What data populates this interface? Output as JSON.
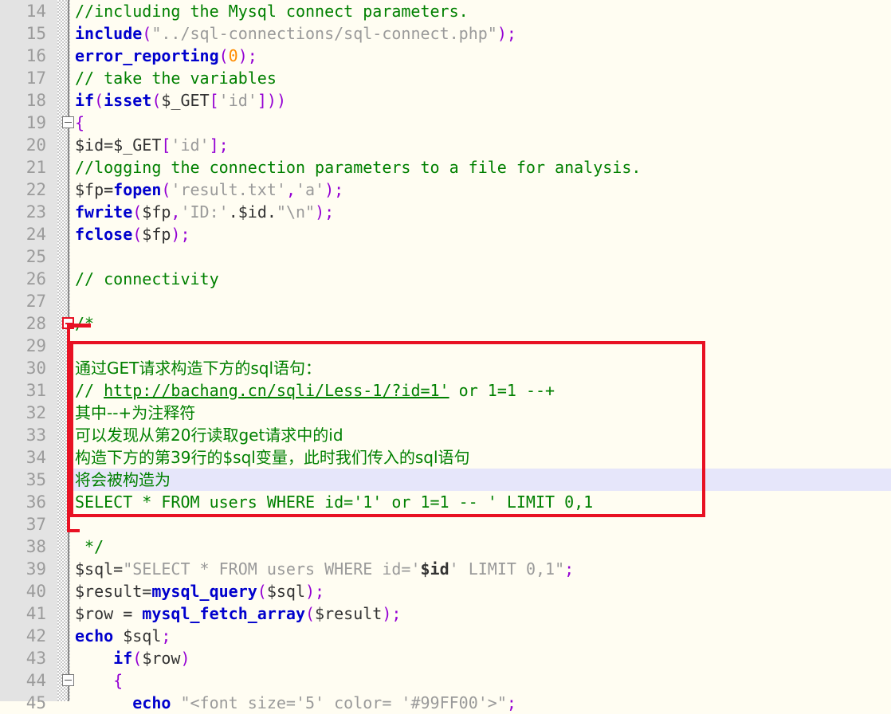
{
  "editor": {
    "title": "php-code-editor",
    "language": "PHP",
    "current_line": 35,
    "first_visible_line": 14,
    "last_visible_line": 45,
    "colors": {
      "background": "#fffdf2",
      "gutter_background": "#e3e3e3",
      "line_number": "#9b9b9b",
      "current_line_highlight": "#e6e6fa",
      "comment": "#008000",
      "keyword": "#0000cd",
      "function": "#0000cd",
      "string": "#9a9a9a",
      "punctuation": "#9400d3",
      "number": "#ff8c00",
      "annotation_box_border": "#e81123",
      "fold_marker_red": "#e81123"
    }
  },
  "annotation": {
    "name": "red-highlight-box",
    "covers_lines": [
      30,
      36
    ],
    "border_color": "#e81123"
  },
  "fold_markers": [
    {
      "line": 19,
      "type": "collapse",
      "color": "gray"
    },
    {
      "line": 28,
      "type": "collapse",
      "color": "red"
    },
    {
      "line": 44,
      "type": "collapse",
      "color": "gray"
    }
  ],
  "lines": [
    {
      "number": 14,
      "text": "//including the Mysql connect parameters.",
      "tokens": [
        {
          "t": "//including the Mysql connect parameters.",
          "c": "cmt"
        }
      ]
    },
    {
      "number": 15,
      "text": "include(\"../sql-connections/sql-connect.php\");",
      "tokens": [
        {
          "t": "include",
          "c": "kw"
        },
        {
          "t": "(",
          "c": "punct"
        },
        {
          "t": "\"../sql-connections/sql-connect.php\"",
          "c": "str"
        },
        {
          "t": ")",
          "c": "punct"
        },
        {
          "t": ";",
          "c": "punct"
        }
      ]
    },
    {
      "number": 16,
      "text": "error_reporting(0);",
      "tokens": [
        {
          "t": "error_reporting",
          "c": "fn"
        },
        {
          "t": "(",
          "c": "punct"
        },
        {
          "t": "0",
          "c": "num"
        },
        {
          "t": ")",
          "c": "punct"
        },
        {
          "t": ";",
          "c": "punct"
        }
      ]
    },
    {
      "number": 17,
      "text": "// take the variables",
      "tokens": [
        {
          "t": "// take the variables",
          "c": "cmt"
        }
      ]
    },
    {
      "number": 18,
      "text": "if(isset($_GET['id']))",
      "tokens": [
        {
          "t": "if",
          "c": "kw"
        },
        {
          "t": "(",
          "c": "punct"
        },
        {
          "t": "isset",
          "c": "fn"
        },
        {
          "t": "(",
          "c": "punct"
        },
        {
          "t": "$_GET",
          "c": "plain"
        },
        {
          "t": "[",
          "c": "punct"
        },
        {
          "t": "'id'",
          "c": "str"
        },
        {
          "t": "]",
          "c": "punct"
        },
        {
          "t": ")",
          "c": "punct"
        },
        {
          "t": ")",
          "c": "punct"
        }
      ]
    },
    {
      "number": 19,
      "text": "{",
      "tokens": [
        {
          "t": "{",
          "c": "punct"
        }
      ]
    },
    {
      "number": 20,
      "text": "$id=$_GET['id'];",
      "tokens": [
        {
          "t": "$id=$_GET",
          "c": "plain"
        },
        {
          "t": "[",
          "c": "punct"
        },
        {
          "t": "'id'",
          "c": "str"
        },
        {
          "t": "]",
          "c": "punct"
        },
        {
          "t": ";",
          "c": "punct"
        }
      ]
    },
    {
      "number": 21,
      "text": "//logging the connection parameters to a file for analysis.",
      "tokens": [
        {
          "t": "//logging the connection parameters to a file for analysis.",
          "c": "cmt"
        }
      ]
    },
    {
      "number": 22,
      "text": "$fp=fopen('result.txt','a');",
      "tokens": [
        {
          "t": "$fp=",
          "c": "plain"
        },
        {
          "t": "fopen",
          "c": "fn"
        },
        {
          "t": "(",
          "c": "punct"
        },
        {
          "t": "'result.txt'",
          "c": "str"
        },
        {
          "t": ",",
          "c": "punct"
        },
        {
          "t": "'a'",
          "c": "str"
        },
        {
          "t": ")",
          "c": "punct"
        },
        {
          "t": ";",
          "c": "punct"
        }
      ]
    },
    {
      "number": 23,
      "text": "fwrite($fp,'ID:'.$id.\"\\n\");",
      "tokens": [
        {
          "t": "fwrite",
          "c": "fn"
        },
        {
          "t": "(",
          "c": "punct"
        },
        {
          "t": "$fp",
          "c": "plain"
        },
        {
          "t": ",",
          "c": "punct"
        },
        {
          "t": "'ID:'",
          "c": "str"
        },
        {
          "t": ".",
          "c": "plain"
        },
        {
          "t": "$id",
          "c": "plain"
        },
        {
          "t": ".",
          "c": "plain"
        },
        {
          "t": "\"\\n\"",
          "c": "str"
        },
        {
          "t": ")",
          "c": "punct"
        },
        {
          "t": ";",
          "c": "punct"
        }
      ]
    },
    {
      "number": 24,
      "text": "fclose($fp);",
      "tokens": [
        {
          "t": "fclose",
          "c": "fn"
        },
        {
          "t": "(",
          "c": "punct"
        },
        {
          "t": "$fp",
          "c": "plain"
        },
        {
          "t": ")",
          "c": "punct"
        },
        {
          "t": ";",
          "c": "punct"
        }
      ]
    },
    {
      "number": 25,
      "text": "",
      "tokens": []
    },
    {
      "number": 26,
      "text": "// connectivity",
      "tokens": [
        {
          "t": "// connectivity",
          "c": "cmt"
        }
      ]
    },
    {
      "number": 27,
      "text": "",
      "tokens": []
    },
    {
      "number": 28,
      "text": "/*",
      "tokens": [
        {
          "t": "/*",
          "c": "cmt"
        }
      ]
    },
    {
      "number": 29,
      "text": "",
      "tokens": []
    },
    {
      "number": 30,
      "text": "通过GET请求构造下方的sql语句：",
      "tokens": [
        {
          "t": "通过GET请求构造下方的sql语句：",
          "c": "cmt cjk"
        }
      ]
    },
    {
      "number": 31,
      "text": "// http://bachang.cn/sqli/Less-1/?id=1' or 1=1 --+",
      "tokens": [
        {
          "t": "// ",
          "c": "cmt"
        },
        {
          "t": "http://bachang.cn/sqli/Less-1/?id=1'",
          "c": "link"
        },
        {
          "t": " or 1=1 --+",
          "c": "cmt"
        }
      ]
    },
    {
      "number": 32,
      "text": "其中--+为注释符",
      "tokens": [
        {
          "t": "其中--+为注释符",
          "c": "cmt cjk"
        }
      ]
    },
    {
      "number": 33,
      "text": "可以发现从第20行读取get请求中的id",
      "tokens": [
        {
          "t": "可以发现从第20行读取get请求中的id",
          "c": "cmt cjk"
        }
      ]
    },
    {
      "number": 34,
      "text": "构造下方的第39行的$sql变量，此时我们传入的sql语句",
      "tokens": [
        {
          "t": "构造下方的第39行的$sql变量，此时我们传入的sql语句",
          "c": "cmt cjk"
        }
      ]
    },
    {
      "number": 35,
      "text": "将会被构造为",
      "current": true,
      "tokens": [
        {
          "t": "将会被构造为",
          "c": "cmt cjk"
        }
      ]
    },
    {
      "number": 36,
      "text": "SELECT * FROM users WHERE id='1' or 1=1 -- ' LIMIT 0,1",
      "tokens": [
        {
          "t": "SELECT * FROM users WHERE id='1' or 1=1 -- ' LIMIT 0,1",
          "c": "cmt"
        }
      ]
    },
    {
      "number": 37,
      "text": "",
      "tokens": []
    },
    {
      "number": 38,
      "text": " */",
      "tokens": [
        {
          "t": " */",
          "c": "cmt"
        }
      ]
    },
    {
      "number": 39,
      "text": "$sql=\"SELECT * FROM users WHERE id='$id' LIMIT 0,1\";",
      "tokens": [
        {
          "t": "$sql=",
          "c": "plain"
        },
        {
          "t": "\"SELECT * FROM users WHERE id='",
          "c": "str"
        },
        {
          "t": "$id",
          "c": "bold"
        },
        {
          "t": "'",
          "c": "str"
        },
        {
          "t": " LIMIT 0,1\"",
          "c": "str"
        },
        {
          "t": ";",
          "c": "punct"
        }
      ]
    },
    {
      "number": 40,
      "text": "$result=mysql_query($sql);",
      "tokens": [
        {
          "t": "$result=",
          "c": "plain"
        },
        {
          "t": "mysql_query",
          "c": "fn"
        },
        {
          "t": "(",
          "c": "punct"
        },
        {
          "t": "$sql",
          "c": "plain"
        },
        {
          "t": ")",
          "c": "punct"
        },
        {
          "t": ";",
          "c": "punct"
        }
      ]
    },
    {
      "number": 41,
      "text": "$row = mysql_fetch_array($result);",
      "tokens": [
        {
          "t": "$row = ",
          "c": "plain"
        },
        {
          "t": "mysql_fetch_array",
          "c": "fn"
        },
        {
          "t": "(",
          "c": "punct"
        },
        {
          "t": "$result",
          "c": "plain"
        },
        {
          "t": ")",
          "c": "punct"
        },
        {
          "t": ";",
          "c": "punct"
        }
      ]
    },
    {
      "number": 42,
      "text": "echo $sql;",
      "tokens": [
        {
          "t": "echo",
          "c": "kw"
        },
        {
          "t": " $sql",
          "c": "plain"
        },
        {
          "t": ";",
          "c": "punct"
        }
      ]
    },
    {
      "number": 43,
      "text": "    if($row)",
      "tokens": [
        {
          "t": "    ",
          "c": "plain"
        },
        {
          "t": "if",
          "c": "kw"
        },
        {
          "t": "(",
          "c": "punct"
        },
        {
          "t": "$row",
          "c": "plain"
        },
        {
          "t": ")",
          "c": "punct"
        }
      ]
    },
    {
      "number": 44,
      "text": "    {",
      "tokens": [
        {
          "t": "    ",
          "c": "plain"
        },
        {
          "t": "{",
          "c": "punct"
        }
      ]
    },
    {
      "number": 45,
      "text": "      echo \"<font size='5' color= '#99FF00'>\";",
      "tokens": [
        {
          "t": "      ",
          "c": "plain"
        },
        {
          "t": "echo",
          "c": "kw"
        },
        {
          "t": " ",
          "c": "plain"
        },
        {
          "t": "\"<font size='5' color= '#99FF00'>\"",
          "c": "str"
        },
        {
          "t": ";",
          "c": "punct"
        }
      ]
    }
  ]
}
